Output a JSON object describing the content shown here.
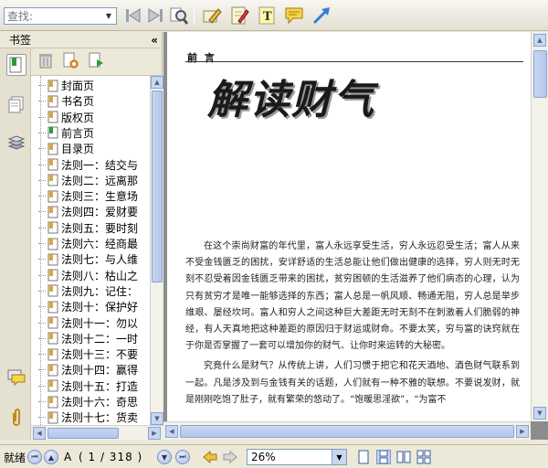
{
  "toolbar": {
    "search_placeholder": "查找:",
    "icons": [
      "back-icon",
      "forward-icon",
      "find-icon",
      "highlight-pen-icon",
      "notepad-icon",
      "text-tool-icon",
      "comment-icon",
      "arrow-icon"
    ]
  },
  "sidebar": {
    "title": "书签",
    "collapse_glyph": "«",
    "bookmarks": [
      "封面页",
      "书名页",
      "版权页",
      "前言页",
      "目录页",
      "法则一：结交与",
      "法则二：远离那",
      "法则三：生意场",
      "法则四：爱财要",
      "法则五：要时刻",
      "法则六：经商最",
      "法则七：与人维",
      "法则八：枯山之",
      "法则九：记住：",
      "法则十：保护好",
      "法则十一：勿以",
      "法则十二：一时",
      "法则十三：不要",
      "法则十四：赢得",
      "法则十五：打造",
      "法则十六：奇思",
      "法则十七：货卖"
    ]
  },
  "document": {
    "section_label": "前 言",
    "title": "解读财气",
    "paragraphs": [
      "在这个崇尚财富的年代里，富人永远享受生活，穷人永远忍受生活；富人从来不受金钱匮乏的困扰，安详舒适的生活总能让他们做出健康的选择，穷人则无时无刻不忍受着因金钱匮乏带来的困扰，贫穷困顿的生活滋养了他们病态的心理，认为只有贫穷才是唯一能够选择的东西；富人总是一帆风顺、畅通无阻，穷人总是举步维艰、屡经坎坷。富人和穷人之间这种巨大差距无时无刻不在刺激着人们脆弱的神经，有人天真地把这种差距的原因归于财运或财命。不要太笑，穷与富的诀窍就在于你是否掌握了一套可以增加你的财气、让你时来运转的大秘密。",
      "究竟什么是财气？从传统上讲，人们习惯于把它和花天酒地、酒色财气联系到一起。凡是涉及到与金钱有关的话题，人们就有一种不雅的联想。不要说发财，就是刚刚吃饱了肚子，就有繁荣的悠动了。“饱暖思淫欲”，“为富不"
    ]
  },
  "statusbar": {
    "status_text": "就绪",
    "page_label": "A",
    "page_indicator": "( 1 / 318 )",
    "zoom": "26%"
  },
  "colors": {
    "chrome": "#ece9d8",
    "scroll_accent": "#b3c6ea",
    "doc_bg": "#8c8c8c"
  }
}
